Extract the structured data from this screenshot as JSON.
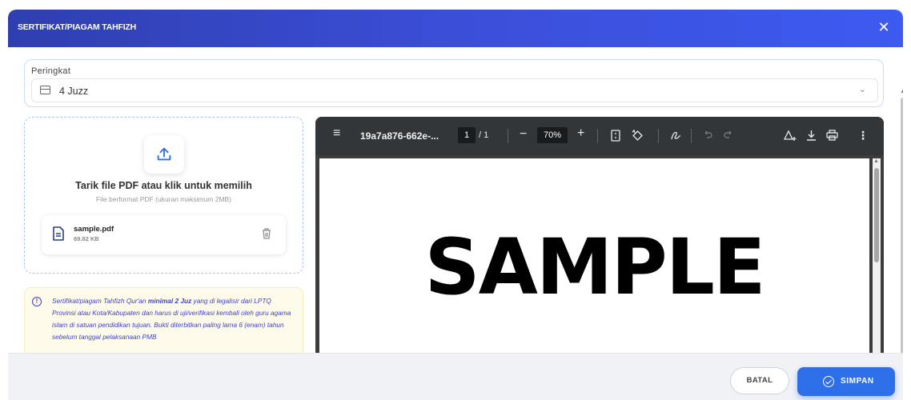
{
  "modal": {
    "title": "SERTIFIKAT/PIAGAM TAHFIZH",
    "close_glyph": "✕"
  },
  "rank": {
    "label": "Peringkat",
    "value": "4 Juzz",
    "icon": "card-icon",
    "chevron": "⌄"
  },
  "upload": {
    "title": "Tarik file PDF atau klik untuk memilih",
    "subtitle": "File berformat PDF (ukuran maksimum 2MB)",
    "icon": "upload-icon",
    "file": {
      "name": "sample.pdf",
      "size": "69.82 KB",
      "icon": "document-icon",
      "delete_icon": "trash-icon"
    }
  },
  "notice": {
    "icon_glyph": "!",
    "text_before": "Sertifikat/piagam Tahfizh Qur'an ",
    "text_bold": "minimal 2 Juz",
    "text_after": " yang di legalisir dari LPTQ Provinsi atau Kota/Kabupaten dan harus di uji/verifikasi kembali oleh guru agama islam di satuan pendidikan tujuan. Bukti diterbitkan paling lama 6 (enam) tahun sebelum tanggal pelaksanaan PMB"
  },
  "pdf_viewer": {
    "filename": "19a7a876-662e-...",
    "page_current": "1",
    "page_total": "/ 1",
    "zoom": "70%",
    "minus_glyph": "−",
    "plus_glyph": "+",
    "menu_glyph": "≡",
    "more_glyph": "⋮",
    "page_text": "SAMPLE"
  },
  "footer": {
    "cancel_label": "BATAL",
    "save_label": "SIMPAN"
  },
  "colors": {
    "header_start": "#2f3fb0",
    "header_end": "#3d5af1",
    "primary": "#2d6fe8",
    "notice_text": "#3b3fd0",
    "notice_bg": "#fefbea"
  }
}
